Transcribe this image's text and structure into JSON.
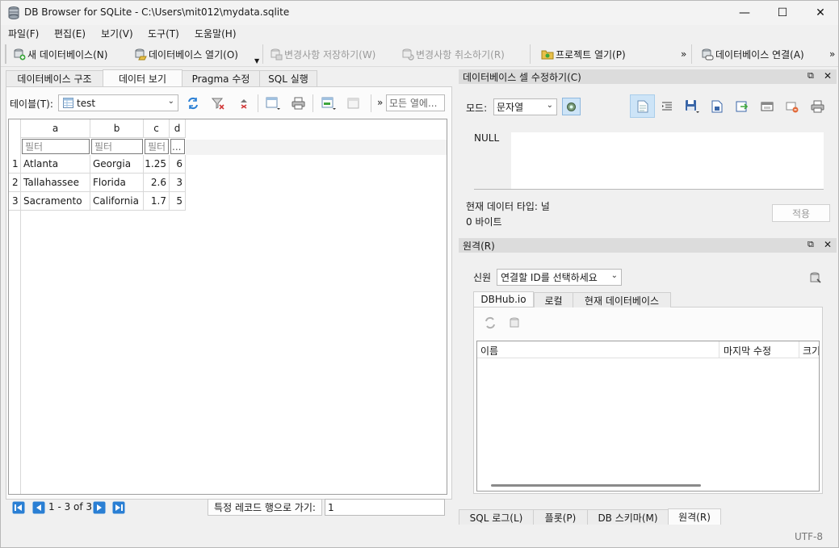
{
  "window": {
    "title": "DB Browser for SQLite - C:\\Users\\mit012\\mydata.sqlite",
    "minimize": "—",
    "maximize": "☐",
    "close": "✕"
  },
  "menu": [
    "파일(F)",
    "편집(E)",
    "보기(V)",
    "도구(T)",
    "도움말(H)"
  ],
  "toolbar": {
    "new_db": "새 데이터베이스(N)",
    "open_db": "데이터베이스 열기(O)",
    "write_changes": "변경사항 저장하기(W)",
    "revert_changes": "변경사항 취소하기(R)",
    "open_project": "프로젝트 열기(P)",
    "overflow": "»",
    "attach_db": "데이터베이스 연결(A)",
    "overflow2": "»"
  },
  "main_tabs": [
    "데이터베이스 구조",
    "데이터 보기",
    "Pragma 수정",
    "SQL 실행"
  ],
  "browse": {
    "table_label": "테이블(T):",
    "table_value": "test",
    "more_label": "»",
    "filter_all_placeholder": "모든 열에...",
    "columns": [
      "a",
      "b",
      "c",
      "d"
    ],
    "filter_placeholder": "필터",
    "filter_ellipsis": "...",
    "rows": [
      {
        "n": "1",
        "a": "Atlanta",
        "b": "Georgia",
        "c": "1.25",
        "d": "6"
      },
      {
        "n": "2",
        "a": "Tallahassee",
        "b": "Florida",
        "c": "2.6",
        "d": "3"
      },
      {
        "n": "3",
        "a": "Sacramento",
        "b": "California",
        "c": "1.7",
        "d": "5"
      }
    ],
    "record_status": "1 - 3 of 3",
    "goto_label": "특정 레코드 행으로 가기:",
    "goto_value": "1"
  },
  "edit_cell": {
    "title": "데이터베이스 셀 수정하기(C)",
    "mode_label": "모드:",
    "mode_value": "문자열",
    "null_text": "NULL",
    "type_text": "현재 데이터 타입: 널",
    "size_text": "0 바이트",
    "apply": "적용"
  },
  "remote": {
    "title": "원격(R)",
    "identity_label": "신원",
    "identity_value": "연결할 ID를 선택하세요",
    "tabs": [
      "DBHub.io",
      "로컬",
      "현재 데이터베이스"
    ],
    "col_name": "이름",
    "col_modified": "마지막 수정",
    "col_size": "크기"
  },
  "bottom_tabs": [
    "SQL 로그(L)",
    "플롯(P)",
    "DB 스키마(M)",
    "원격(R)"
  ],
  "statusbar": {
    "encoding": "UTF-8"
  },
  "colors": {
    "accent": "#2a7fd4",
    "dock_header": "#dcdcdc",
    "selected_button": "#cde4f7"
  }
}
